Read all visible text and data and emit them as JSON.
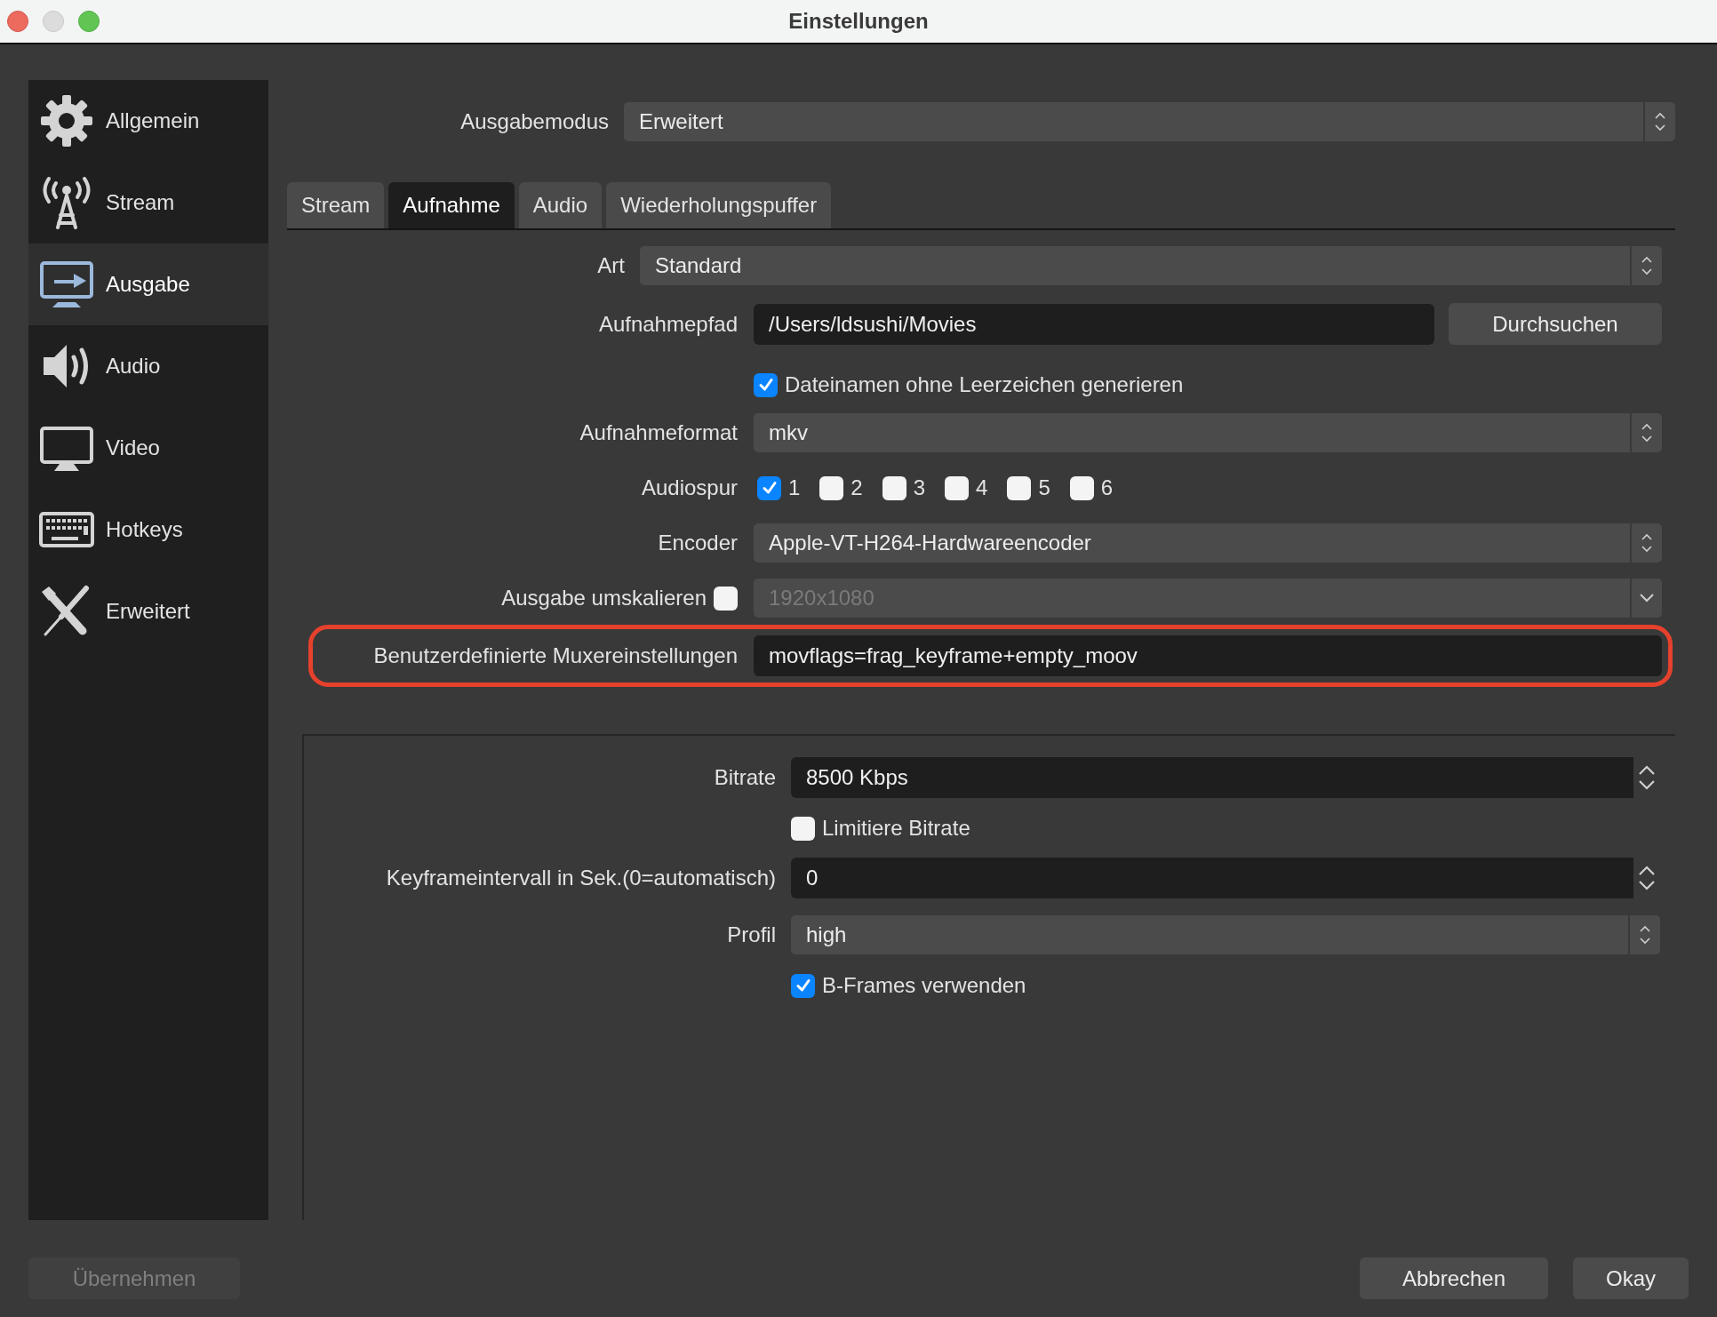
{
  "window": {
    "title": "Einstellungen"
  },
  "sidebar": {
    "items": [
      {
        "label": "Allgemein",
        "kind": "gear",
        "selected": false
      },
      {
        "label": "Stream",
        "kind": "antenna",
        "selected": false
      },
      {
        "label": "Ausgabe",
        "kind": "output",
        "selected": true
      },
      {
        "label": "Audio",
        "kind": "speaker",
        "selected": false
      },
      {
        "label": "Video",
        "kind": "monitor",
        "selected": false
      },
      {
        "label": "Hotkeys",
        "kind": "keyboard",
        "selected": false
      },
      {
        "label": "Erweitert",
        "kind": "tools",
        "selected": false
      }
    ]
  },
  "output_mode": {
    "label": "Ausgabemodus",
    "value": "Erweitert"
  },
  "tabs": [
    {
      "label": "Stream",
      "selected": false
    },
    {
      "label": "Aufnahme",
      "selected": true
    },
    {
      "label": "Audio",
      "selected": false
    },
    {
      "label": "Wiederholungspuffer",
      "selected": false
    }
  ],
  "recording": {
    "type": {
      "label": "Art",
      "value": "Standard"
    },
    "path": {
      "label": "Aufnahmepfad",
      "value": "/Users/ldsushi/Movies",
      "button": "Durchsuchen"
    },
    "no_spaces": {
      "label": "Dateinamen ohne Leerzeichen generieren",
      "checked": true
    },
    "format": {
      "label": "Aufnahmeformat",
      "value": "mkv"
    },
    "audio_tracks": {
      "label": "Audiospur",
      "tracks": [
        {
          "label": "1",
          "checked": true
        },
        {
          "label": "2",
          "checked": false
        },
        {
          "label": "3",
          "checked": false
        },
        {
          "label": "4",
          "checked": false
        },
        {
          "label": "5",
          "checked": false
        },
        {
          "label": "6",
          "checked": false
        }
      ]
    },
    "encoder": {
      "label": "Encoder",
      "value": "Apple-VT-H264-Hardwareencoder"
    },
    "rescale": {
      "label": "Ausgabe umskalieren",
      "checked": false,
      "value": "1920x1080",
      "disabled": true
    },
    "muxer": {
      "label": "Benutzerdefinierte Muxereinstellungen",
      "value": "movflags=frag_keyframe+empty_moov",
      "highlighted": true
    }
  },
  "encoder_settings": {
    "bitrate": {
      "label": "Bitrate",
      "value": "8500 Kbps"
    },
    "limit_bitrate": {
      "label": "Limitiere Bitrate",
      "checked": false
    },
    "keyframe": {
      "label": "Keyframeintervall in Sek.(0=automatisch)",
      "value": "0"
    },
    "profile": {
      "label": "Profil",
      "value": "high"
    },
    "bframes": {
      "label": "B-Frames verwenden",
      "checked": true
    }
  },
  "buttons": {
    "apply": {
      "label": "Übernehmen",
      "disabled": true
    },
    "cancel": "Abbrechen",
    "ok": "Okay"
  }
}
